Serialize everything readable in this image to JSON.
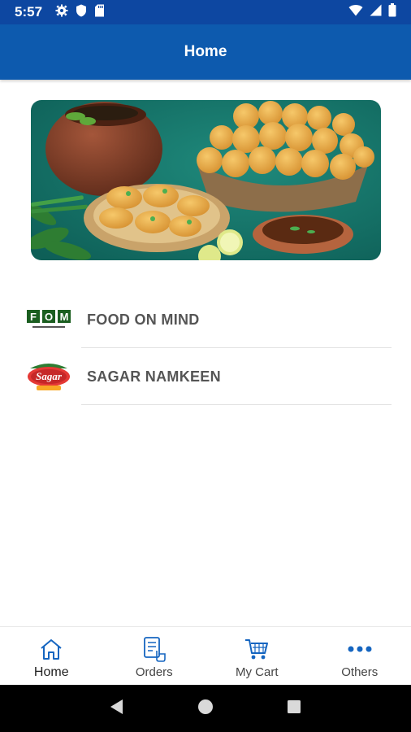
{
  "status": {
    "time": "5:57",
    "left_icons": [
      "gear-icon",
      "shield-icon",
      "sd-card-icon"
    ],
    "right_icons": [
      "wifi-icon",
      "signal-icon",
      "battery-icon"
    ]
  },
  "app_bar": {
    "title": "Home"
  },
  "banner": {
    "image": "pani-puri-food-banner"
  },
  "vendors": [
    {
      "name": "FOOD ON MIND",
      "logo": "fom-logo"
    },
    {
      "name": "SAGAR NAMKEEN",
      "logo": "sagar-logo"
    }
  ],
  "logos": {
    "fom_text": "FOM",
    "sagar_text": "Sagar"
  },
  "bottom_nav": [
    {
      "label": "Home",
      "icon": "home-icon",
      "active": true
    },
    {
      "label": "Orders",
      "icon": "orders-icon",
      "active": false
    },
    {
      "label": "My Cart",
      "icon": "cart-icon",
      "active": false
    },
    {
      "label": "Others",
      "icon": "more-icon",
      "active": false
    }
  ],
  "colors": {
    "primary": "#0d5aae",
    "status_bar": "#0d47a1",
    "accent": "#1565c0"
  }
}
